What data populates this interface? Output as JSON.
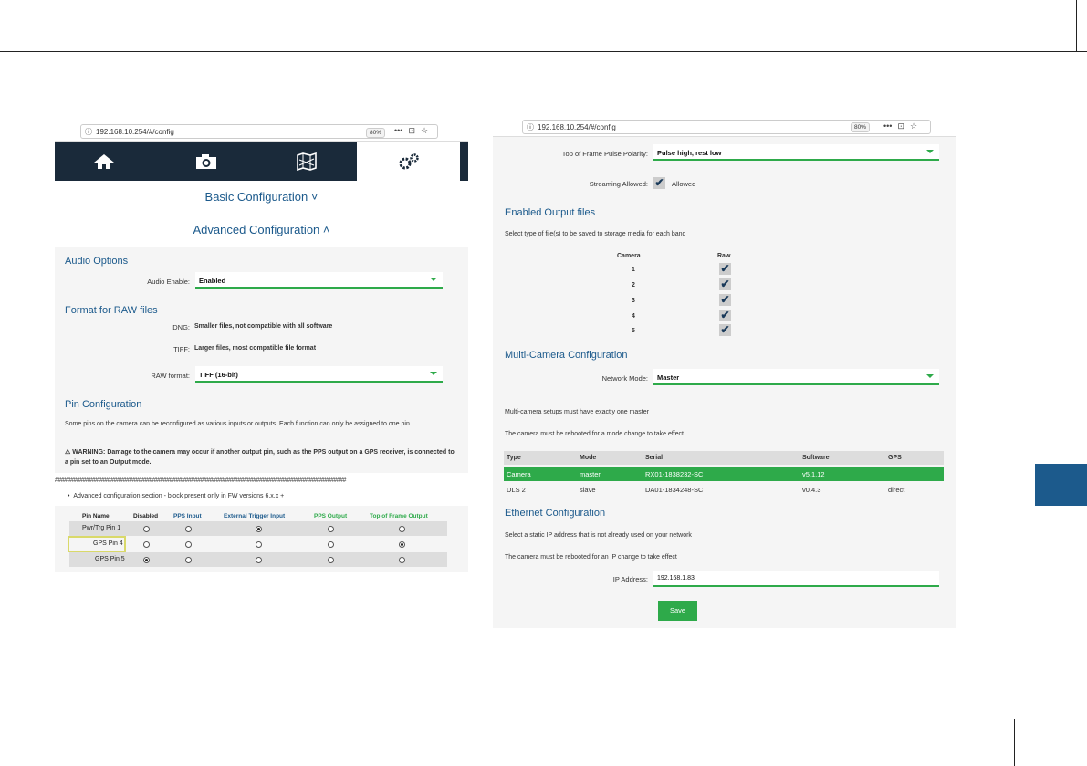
{
  "left": {
    "url": "192.168.10.254/#/config",
    "zoom": "80%",
    "nav": [
      "home-icon",
      "camera-icon",
      "map-icon",
      "settings-icon"
    ],
    "basic_heading": "Basic Configuration ˅",
    "advanced_heading": "Advanced Configuration ˄",
    "audio_section": "Audio Options",
    "audio_label": "Audio Enable:",
    "audio_value": "Enabled",
    "raw_section": "Format for RAW files",
    "dng_label": "DNG:",
    "dng_text": "Smaller files, not compatible with all software",
    "tiff_label": "TIFF:",
    "tiff_text": "Larger files, most compatible file format",
    "raw_label": "RAW format:",
    "raw_value": "TIFF (16-bit)",
    "pin_section": "Pin Configuration",
    "pin_text": "Some pins on the camera can be reconfigured as various inputs or outputs. Each function can only be assigned to one pin.",
    "warning": "⚠ WARNING: Damage to the camera may occur if another output pin, such as the PPS output on a GPS receiver, is connected to a pin set to an Output mode.",
    "hash_line": "##############################################################################################",
    "bullet": "Advanced configuration section - block present only in FW versions 6.x.x +",
    "pin_table": {
      "headers": [
        "Pin Name",
        "Disabled",
        "PPS Input",
        "External Trigger Input",
        "PPS Output",
        "Top of Frame Output"
      ],
      "rows": [
        {
          "name": "Pwr/Trg Pin 1",
          "selected": 2
        },
        {
          "name": "GPS Pin 4",
          "selected": 4
        },
        {
          "name": "GPS Pin 5",
          "selected": 0
        }
      ]
    }
  },
  "right": {
    "url": "192.168.10.254/#/config",
    "zoom": "80%",
    "tof_label": "Top of Frame Pulse Polarity:",
    "tof_value": "Pulse high, rest low",
    "stream_label": "Streaming Allowed:",
    "stream_value": "Allowed",
    "output_section": "Enabled Output files",
    "output_text": "Select type of file(s) to be saved to storage media for each band",
    "camera_header": "Camera",
    "raw_header": "Raw",
    "cameras": [
      "1",
      "2",
      "3",
      "4",
      "5"
    ],
    "multi_section": "Multi-Camera Configuration",
    "network_label": "Network Mode:",
    "network_value": "Master",
    "multi_text1": "Multi-camera setups must have exactly one master",
    "multi_text2": "The camera must be rebooted for a mode change to take effect",
    "dev_table": {
      "headers": [
        "Type",
        "Mode",
        "Serial",
        "Software",
        "GPS"
      ],
      "rows": [
        [
          "Camera",
          "master",
          "RX01-1838232-SC",
          "v5.1.12",
          ""
        ],
        [
          "DLS 2",
          "slave",
          "DA01-1834248-SC",
          "v0.4.3",
          "direct"
        ]
      ]
    },
    "eth_section": "Ethernet Configuration",
    "eth_text1": "Select a static IP address that is not already used on your network",
    "eth_text2": "The camera must be rebooted for an IP change to take effect",
    "ip_label": "IP Address:",
    "ip_value": "192.168.1.83",
    "save": "Save"
  },
  "colors": {
    "accent": "#2eaa4a",
    "heading": "#1c5a8c",
    "navbar": "#1a2a3a",
    "tab": "#1c5a8c"
  }
}
